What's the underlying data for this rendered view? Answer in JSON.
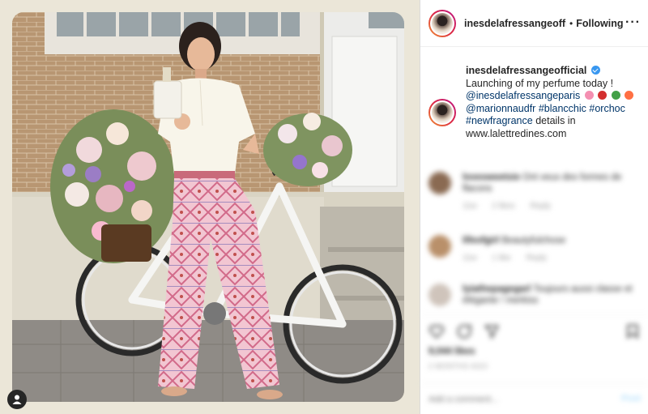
{
  "post": {
    "user_tag_icon": "person-icon"
  },
  "header": {
    "username": "inesdelafressangeofficial",
    "separator": "•",
    "follow_label": "Following",
    "more_icon": "ellipsis-icon",
    "more_label": "···"
  },
  "caption": {
    "username": "inesdelafressangeofficial",
    "line1": "Launching of my perfume today !",
    "mention1": "@inesdelafressangeparis",
    "mention2": "@marionnaudfr",
    "tag1": "#blancchic",
    "tag2": "#orchoc",
    "tag3": "#newfragrance",
    "details": "details in",
    "website": "www.lalettredines.com",
    "emoji_colors": [
      "#f48fb1",
      "#d32f2f",
      "#43a047",
      "#ff7043"
    ]
  },
  "comments": [
    {
      "user": "lovesweetsie",
      "text": "Ont veux des formes de flacons",
      "meta": [
        "11w",
        "2 likes",
        "Reply"
      ],
      "avatar_color": "#8a6a52"
    },
    {
      "user": "lifeofgirl",
      "text": "Beautyfulchose",
      "meta": [
        "11w",
        "1 like",
        "Reply"
      ],
      "avatar_color": "#b9906a"
    },
    {
      "user": "lyiathepagegarl",
      "text": "Toujours aussi classe et élégante ! merkiss",
      "meta": [],
      "avatar_color": "#cfc4bb"
    }
  ],
  "actions": {
    "like_icon": "heart-icon",
    "comment_icon": "comment-icon",
    "share_icon": "share-icon",
    "save_icon": "bookmark-icon"
  },
  "likes": "9,044 likes",
  "timestamp": "2 MONTHS AGO",
  "add_comment": {
    "placeholder": "Add a comment...",
    "post_label": "Post"
  }
}
